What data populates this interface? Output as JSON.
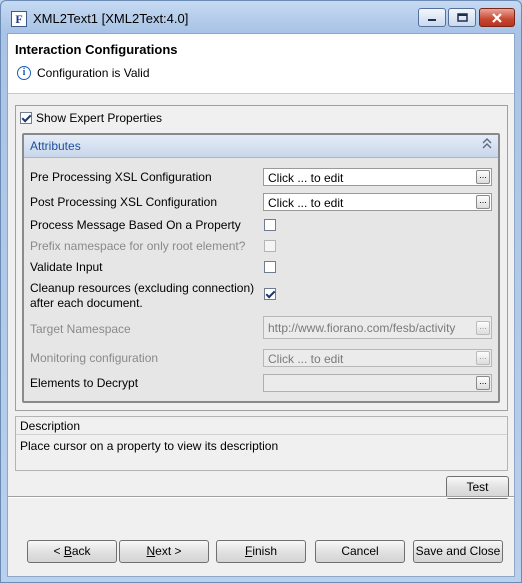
{
  "window": {
    "title": "XML2Text1 [XML2Text:4.0]",
    "app_icon_letter": "F"
  },
  "header": {
    "title": "Interaction Configurations",
    "status": "Configuration is Valid",
    "status_icon": "info-icon"
  },
  "expert": {
    "label": "Show Expert Properties",
    "checked": true
  },
  "attributes": {
    "title": "Attributes",
    "rows": [
      {
        "label": "Pre Processing XSL Configuration",
        "value": "Click ... to edit",
        "ellipsis": "..."
      },
      {
        "label": "Post Processing XSL Configuration",
        "value": "Click ... to edit",
        "ellipsis": "..."
      },
      {
        "label": "Process Message Based On a Property",
        "checked": false
      },
      {
        "label": "Prefix namespace for only root element?",
        "checked": false,
        "disabled": true
      },
      {
        "label": "Validate Input",
        "checked": false
      },
      {
        "label_line1": "Cleanup resources (excluding connection)",
        "label_line2": "after each document.",
        "checked": true
      },
      {
        "label": "Target Namespace",
        "value": "http://www.fiorano.com/fesb/activity",
        "ellipsis": "...",
        "disabled": true
      },
      {
        "label": "Monitoring configuration",
        "value": "Click ... to edit",
        "ellipsis": "...",
        "disabled": true
      },
      {
        "label": "Elements to Decrypt",
        "value": "",
        "ellipsis": "..."
      }
    ]
  },
  "description": {
    "title": "Description",
    "text": "Place cursor on a property to view its description"
  },
  "buttons": {
    "test": "Test",
    "back_mnemonic": "B",
    "back_rest": "ack",
    "back_prefix": "< ",
    "next_mnemonic": "N",
    "next_rest": "ext >",
    "finish_mnemonic": "F",
    "finish_rest": "inish",
    "cancel": "Cancel",
    "save_close": "Save and Close"
  },
  "colors": {
    "accent": "#1f4e9c",
    "titlebar": "#a9c4e6",
    "close_button": "#c94731"
  }
}
